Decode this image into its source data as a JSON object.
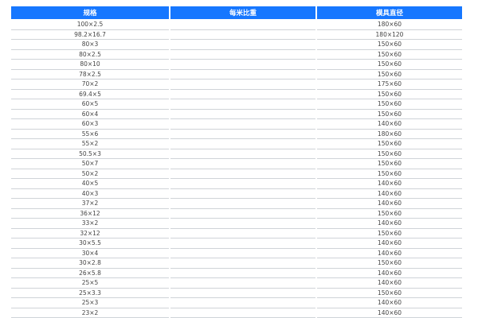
{
  "header": {
    "col1": "规格",
    "col2": "每米比重",
    "col3": "模具直径"
  },
  "rows": [
    {
      "spec": "100×2.5",
      "weight": "",
      "die": "180×60"
    },
    {
      "spec": "98.2×16.7",
      "weight": "",
      "die": "180×120"
    },
    {
      "spec": "80×3",
      "weight": "",
      "die": "150×60"
    },
    {
      "spec": "80×2.5",
      "weight": "",
      "die": "150×60"
    },
    {
      "spec": "80×10",
      "weight": "",
      "die": "150×60"
    },
    {
      "spec": "78×2.5",
      "weight": "",
      "die": "150×60"
    },
    {
      "spec": "70×2",
      "weight": "",
      "die": "175×60"
    },
    {
      "spec": "69.4×5",
      "weight": "",
      "die": "150×60"
    },
    {
      "spec": "60×5",
      "weight": "",
      "die": "150×60"
    },
    {
      "spec": "60×4",
      "weight": "",
      "die": "150×60"
    },
    {
      "spec": "60×3",
      "weight": "",
      "die": "140×60"
    },
    {
      "spec": "55×6",
      "weight": "",
      "die": "180×60"
    },
    {
      "spec": "55×2",
      "weight": "",
      "die": "150×60"
    },
    {
      "spec": "50.5×3",
      "weight": "",
      "die": "150×60"
    },
    {
      "spec": "50×7",
      "weight": "",
      "die": "150×60"
    },
    {
      "spec": "50×2",
      "weight": "",
      "die": "150×60"
    },
    {
      "spec": "40×5",
      "weight": "",
      "die": "140×60"
    },
    {
      "spec": "40×3",
      "weight": "",
      "die": "140×60"
    },
    {
      "spec": "37×2",
      "weight": "",
      "die": "140×60"
    },
    {
      "spec": "36×12",
      "weight": "",
      "die": "150×60"
    },
    {
      "spec": "33×2",
      "weight": "",
      "die": "140×60"
    },
    {
      "spec": "32×12",
      "weight": "",
      "die": "150×60"
    },
    {
      "spec": "30×5.5",
      "weight": "",
      "die": "140×60"
    },
    {
      "spec": "30×4",
      "weight": "",
      "die": "140×60"
    },
    {
      "spec": "30×2.8",
      "weight": "",
      "die": "150×60"
    },
    {
      "spec": "26×5.8",
      "weight": "",
      "die": "140×60"
    },
    {
      "spec": "25×5",
      "weight": "",
      "die": "140×60"
    },
    {
      "spec": "25×3.3",
      "weight": "",
      "die": "150×60"
    },
    {
      "spec": "25×3",
      "weight": "",
      "die": "140×60"
    },
    {
      "spec": "23×2",
      "weight": "",
      "die": "140×60"
    }
  ]
}
